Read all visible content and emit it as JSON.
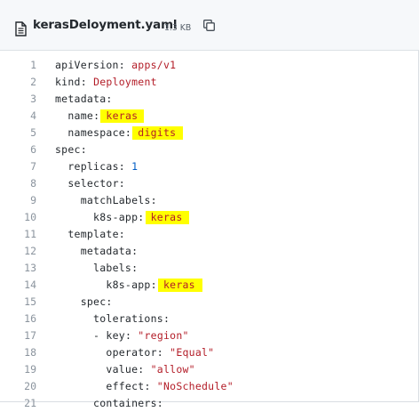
{
  "file": {
    "name": "kerasDeloyment.yaml",
    "size": "1.3 KB",
    "icon": "file-icon",
    "copy_icon": "copy-icon"
  },
  "code_lines": [
    {
      "num": "1",
      "key": "apiVersion",
      "sep": ": ",
      "value": "apps/v1",
      "indent": ""
    },
    {
      "num": "2",
      "key": "kind",
      "sep": ": ",
      "value": "Deployment",
      "indent": ""
    },
    {
      "num": "3",
      "key": "metadata",
      "sep": ":",
      "value": "",
      "indent": ""
    },
    {
      "num": "4",
      "key": "name",
      "sep": ": ",
      "value": "keras",
      "indent": "  ",
      "highlight": true
    },
    {
      "num": "5",
      "key": "namespace",
      "sep": ": ",
      "value": "digits",
      "indent": "  ",
      "highlight": true
    },
    {
      "num": "6",
      "key": "spec",
      "sep": ":",
      "value": "",
      "indent": ""
    },
    {
      "num": "7",
      "key": "replicas",
      "sep": ": ",
      "value": "1",
      "indent": "  ",
      "numeric": true
    },
    {
      "num": "8",
      "key": "selector",
      "sep": ":",
      "value": "",
      "indent": "  "
    },
    {
      "num": "9",
      "key": "matchLabels",
      "sep": ":",
      "value": "",
      "indent": "    "
    },
    {
      "num": "10",
      "key": "k8s-app",
      "sep": ": ",
      "value": "keras",
      "indent": "      ",
      "highlight": true
    },
    {
      "num": "11",
      "key": "template",
      "sep": ":",
      "value": "",
      "indent": "  "
    },
    {
      "num": "12",
      "key": "metadata",
      "sep": ":",
      "value": "",
      "indent": "    "
    },
    {
      "num": "13",
      "key": "labels",
      "sep": ":",
      "value": "",
      "indent": "      "
    },
    {
      "num": "14",
      "key": "k8s-app",
      "sep": ": ",
      "value": "keras",
      "indent": "        ",
      "highlight": true
    },
    {
      "num": "15",
      "key": "spec",
      "sep": ":",
      "value": "",
      "indent": "    "
    },
    {
      "num": "16",
      "key": "tolerations",
      "sep": ":",
      "value": "",
      "indent": "      "
    },
    {
      "num": "17",
      "key": "key",
      "sep": ": ",
      "value": "\"region\"",
      "indent": "      ",
      "prefix": "- "
    },
    {
      "num": "18",
      "key": "operator",
      "sep": ": ",
      "value": "\"Equal\"",
      "indent": "        "
    },
    {
      "num": "19",
      "key": "value",
      "sep": ": ",
      "value": "\"allow\"",
      "indent": "        "
    },
    {
      "num": "20",
      "key": "effect",
      "sep": ": ",
      "value": "\"NoSchedule\"",
      "indent": "        "
    },
    {
      "num": "21",
      "key": "containers",
      "sep": ":",
      "value": "",
      "indent": "      "
    }
  ],
  "colors": {
    "key": "#22863a",
    "value": "#b31d28",
    "number": "#005cc5",
    "highlight": "#ffff00",
    "line_number": "#8b949e",
    "header_bg": "#f6f8fa"
  }
}
